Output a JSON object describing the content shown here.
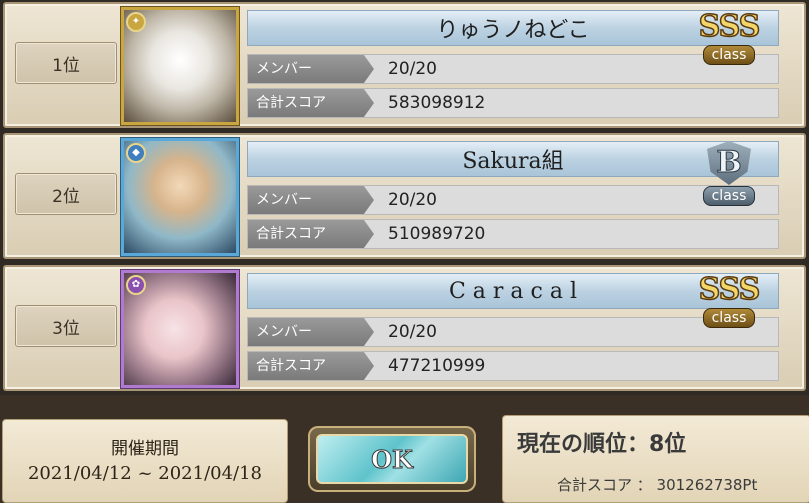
{
  "ranking": [
    {
      "rank_label": "1位",
      "guild_name": "りゅうノねどこ",
      "member_label": "メンバー",
      "member_value": "20/20",
      "score_label": "合計スコア",
      "score_value": "583098912",
      "class_grade": "SSS",
      "class_word": "class",
      "portrait_frame_color": "#c9a640",
      "icon": "gold-character-portrait-icon"
    },
    {
      "rank_label": "2位",
      "guild_name": "Sakura組",
      "member_label": "メンバー",
      "member_value": "20/20",
      "score_label": "合計スコア",
      "score_value": "510989720",
      "class_grade": "B",
      "class_word": "class",
      "portrait_frame_color": "#5aa8d8",
      "icon": "blue-character-portrait-icon"
    },
    {
      "rank_label": "3位",
      "guild_name": "C a r a c a l",
      "member_label": "メンバー",
      "member_value": "20/20",
      "score_label": "合計スコア",
      "score_value": "477210999",
      "class_grade": "SSS",
      "class_word": "class",
      "portrait_frame_color": "#b07ad0",
      "icon": "purple-character-portrait-icon"
    }
  ],
  "period": {
    "title": "開催期間",
    "dates": "2021/04/12 ~ 2021/04/18"
  },
  "ok_button": {
    "label": "OK"
  },
  "current": {
    "rank_text": "現在の順位：8位",
    "score_text": "合計スコア ： 301262738Pt"
  }
}
